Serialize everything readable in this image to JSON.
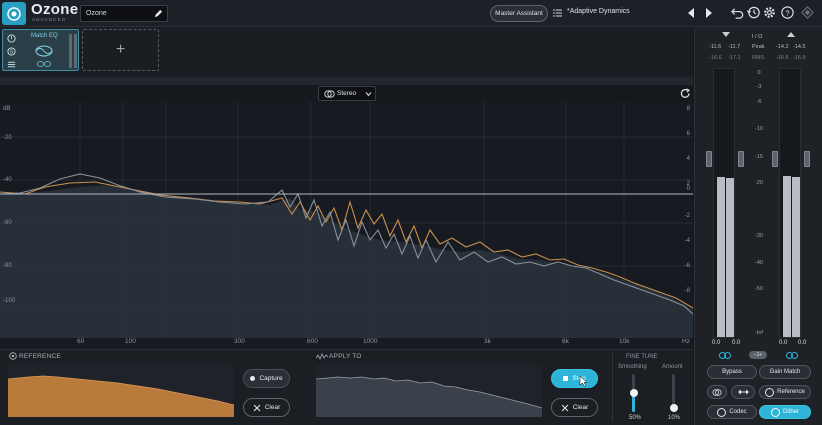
{
  "app": {
    "logo_title": "Ozone",
    "logo_subtitle": "ADVANCED",
    "preset_field": "Ozone",
    "master_assistant": "Master Assistant",
    "preset_name": "*Adaptive Dynamics"
  },
  "modules": [
    {
      "name": "Match EQ",
      "active": true
    }
  ],
  "spectrum": {
    "channel_mode": "Stereo",
    "db_left": [
      "dB",
      "-20",
      "-40",
      "-60",
      "-80",
      "-100"
    ],
    "db_right": [
      "8",
      "6",
      "4",
      "2",
      "0",
      "-2",
      "-4",
      "-6",
      "-8"
    ],
    "freq_ticks": [
      "60",
      "100",
      "300",
      "600",
      "1000",
      "3k",
      "6k",
      "10k",
      "Hz"
    ]
  },
  "reference_panel": {
    "title": "REFERENCE",
    "capture_label": "Capture",
    "clear_label": "Clear"
  },
  "apply_panel": {
    "title": "APPLY TO",
    "action_label": "Stop",
    "clear_label": "Clear"
  },
  "fine_tune": {
    "title": "FINE TUNE",
    "smoothing_label": "Smoothing",
    "smoothing_value": "50%",
    "smoothing_level": 0.5,
    "amount_label": "Amount",
    "amount_value": "10%",
    "amount_level": 0.1
  },
  "meters": {
    "io_label": "I / O",
    "peak_label": "Peak",
    "rms_label": "RMS",
    "input_peak": [
      "-11.6",
      "-11.7"
    ],
    "input_rms": [
      "-16.6",
      "-17.1"
    ],
    "output_peak": [
      "-14.2",
      "-14.5"
    ],
    "output_rms": [
      "-16.6",
      "-16.9"
    ],
    "scale": [
      "0",
      "-3",
      "-6",
      "-10",
      "-15",
      "-20",
      "-30",
      "-40",
      "-50",
      "-Inf"
    ],
    "input_values": [
      "0.0",
      "0.0"
    ],
    "output_values": [
      "0.0",
      "0.0"
    ],
    "link_badge": "−1+"
  },
  "side_buttons": {
    "bypass": "Bypass",
    "gain_match": "Gain Match",
    "reference": "Reference",
    "codec": "Codec",
    "dither": "Dither"
  },
  "colors": {
    "accent": "#2db4d6",
    "reference_curve": "#c8904f",
    "apply_curve": "#8a9099"
  }
}
